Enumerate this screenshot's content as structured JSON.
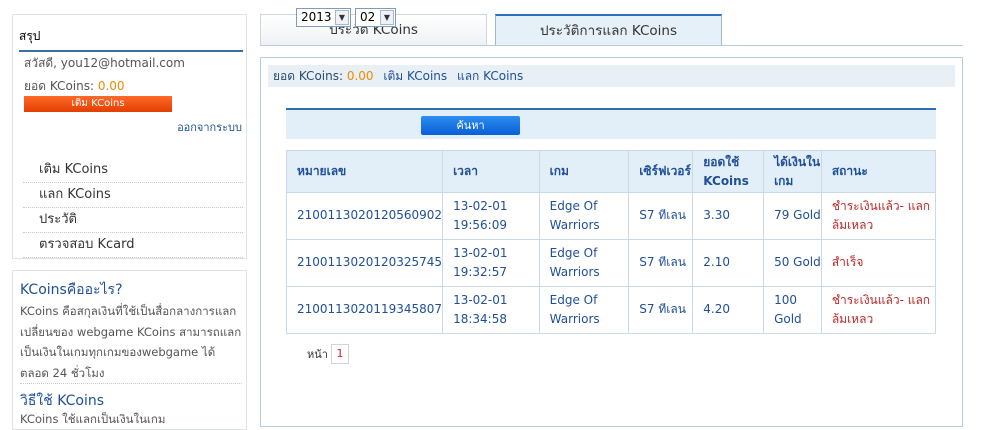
{
  "sidebar": {
    "summary_title": "สรุป",
    "greeting": "สวัสดี, you12@hotmail.com",
    "balance_label": "ยอด KCoins:",
    "balance_value": "0.00",
    "topup_button": "เติม KCoins",
    "logout_link": "ออกจากระบบ",
    "menu": [
      {
        "label": "เติม KCoins"
      },
      {
        "label": "แลก KCoins"
      },
      {
        "label": "ประวัติ"
      },
      {
        "label": "ตรวจสอบ Kcard"
      }
    ],
    "info_title": "KCoinsคืออะไร?",
    "info_text": "KCoins คือสกุลเงินที่ใช้เป็นสื่อกลางการแลกเปลี่ยนของ webgame KCoins สามารถแลกเป็นเงินในเกมทุกเกมของwebgame ได้ตลอด 24 ชั่วโมง",
    "info_title2": "วิธีใช้ KCoins",
    "info_text2": "KCoins ใช้แลกเป็นเงินในเกม"
  },
  "tabs": [
    {
      "label": "ประวัติ KCoins"
    },
    {
      "label": "ประวัติการแลก KCoins"
    }
  ],
  "info_bar": {
    "balance_label": "ยอด KCoins:",
    "balance_value": "0.00",
    "topup_link": "เติม KCoins",
    "exchange_link": "แลก KCoins"
  },
  "filter": {
    "year": "2013",
    "month": "02",
    "search_button": "ค้นหา"
  },
  "table": {
    "headers": [
      "หมายเลข",
      "เวลา",
      "เกม",
      "เซิร์ฟเวอร์",
      "ยอดใช้ KCoins",
      "ได้เงินในเกม",
      "สถานะ"
    ],
    "rows": [
      {
        "id": "210011302012056090​2",
        "time": "13-02-01 19:56:09",
        "game": "Edge Of Warriors",
        "server": "S7 ทีเลน",
        "amount": "3.30",
        "gold": "79 Gold",
        "status": "ชำระเงินแล้ว- แลกล้มเหลว"
      },
      {
        "id": "2100113020120325745",
        "time": "13-02-01 19:32:57",
        "game": "Edge Of Warriors",
        "server": "S7 ทีเลน",
        "amount": "2.10",
        "gold": "50 Gold",
        "status": "สำเร็จ"
      },
      {
        "id": "2100113020119345807",
        "time": "13-02-01 18:34:58",
        "game": "Edge Of Warriors",
        "server": "S7 ทีเลน",
        "amount": "4.20",
        "gold": "100 Gold",
        "status": "ชำระเงินแล้ว- แลกล้มเหลว"
      }
    ]
  },
  "pager": {
    "label": "หน้า",
    "current": "1"
  },
  "colors": {
    "accent": "#2f6db5",
    "balance": "#f08a00",
    "status": "#c0282b"
  }
}
